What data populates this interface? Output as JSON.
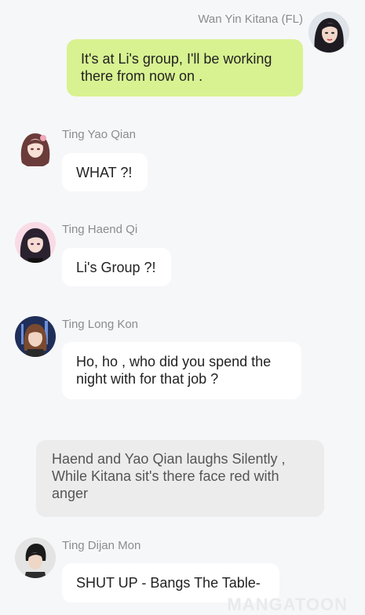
{
  "messages": [
    {
      "sender": "Wan Yin Kitana (FL)",
      "text": "It's at Li's group, I'll be working there from now on .",
      "avatar": "avatar-dark-hair-woman"
    },
    {
      "sender": "Ting Yao Qian",
      "text": "WHAT ?!",
      "avatar": "avatar-brown-hair-girl"
    },
    {
      "sender": "Ting Haend Qi",
      "text": "Li's Group ?!",
      "avatar": "avatar-pink-hair-girl"
    },
    {
      "sender": "Ting Long Kon",
      "text": "Ho, ho , who did you spend the night with for that job ?",
      "avatar": "avatar-brown-hair-boy"
    },
    {
      "sender": "Ting Dijan Mon",
      "text": "SHUT UP - Bangs The Table-",
      "avatar": "avatar-dark-hair-man"
    }
  ],
  "narration": "Haend and Yao Qian laughs Silently , While Kitana sit's there face red with anger",
  "watermark": "MANGATOON",
  "colors": {
    "background": "#f6f7f9",
    "outgoing_bubble": "#d8f291",
    "incoming_bubble": "#ffffff",
    "narration_bubble": "#ececec",
    "sender_name": "#8c8c8c"
  }
}
